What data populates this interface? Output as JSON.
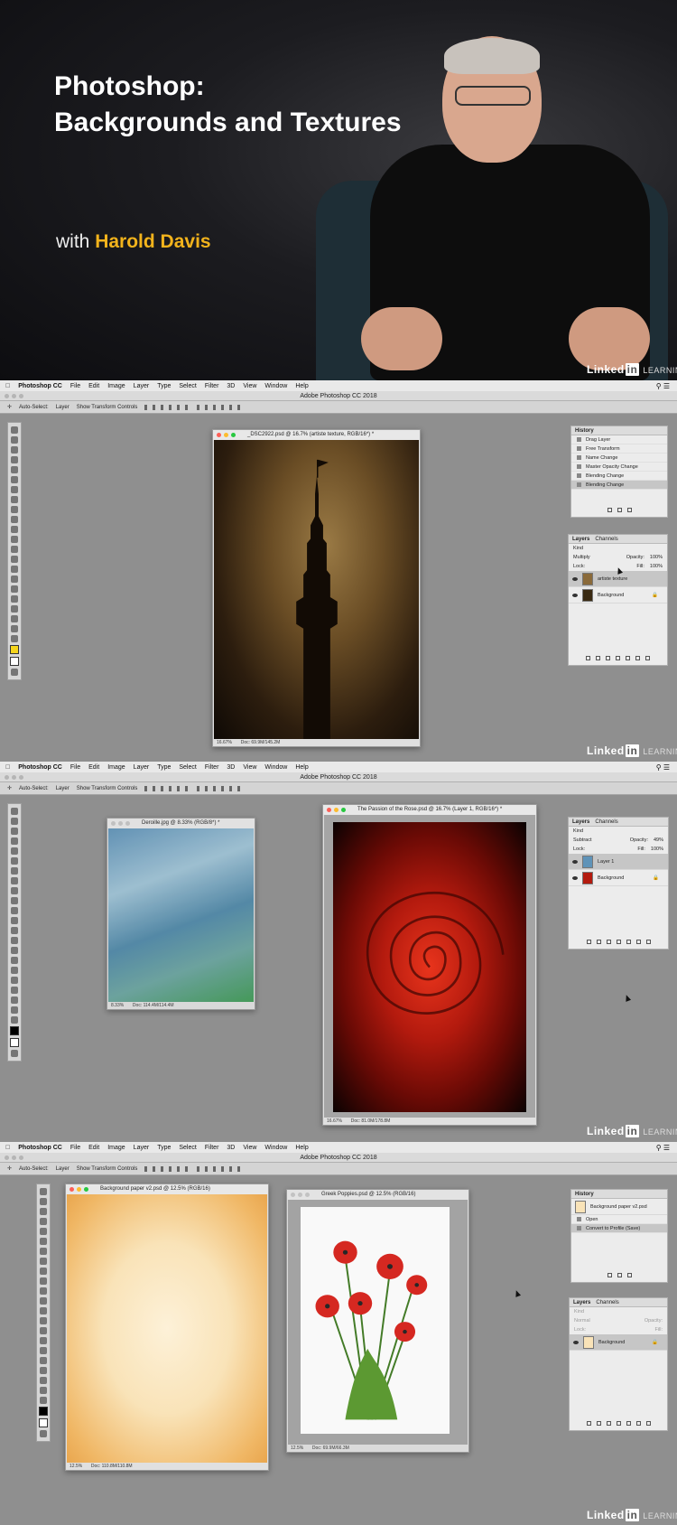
{
  "hero": {
    "title_line1": "Photoshop:",
    "title_line2": "Backgrounds and Textures",
    "with_prefix": "with",
    "author": "Harold Davis",
    "brand_linked": "Linked",
    "brand_in": "in",
    "brand_learning": "LEARNING",
    "accent": "#f2b31c"
  },
  "menubar": {
    "apple_icon": "apple-icon",
    "app": "Photoshop CC",
    "items": [
      "File",
      "Edit",
      "Image",
      "Layer",
      "Type",
      "Select",
      "Filter",
      "3D",
      "View",
      "Window",
      "Help"
    ]
  },
  "app_title": "Adobe Photoshop CC 2018",
  "options": {
    "auto_select": "Auto-Select:",
    "layer": "Layer",
    "show_transform": "Show Transform Controls"
  },
  "shot1": {
    "doc": {
      "title": "_DSC2922.psd @ 16.7% (artiste texture, RGB/16*) *",
      "zoom": "16.67%",
      "size": "Doc: 69.9M/145.2M"
    },
    "history": {
      "tab": "History",
      "items": [
        "Drag Layer",
        "Free Transform",
        "Name Change",
        "Master Opacity Change",
        "Blending Change",
        "Blending Change"
      ]
    },
    "layers": {
      "tab1": "Layers",
      "tab2": "Channels",
      "kind": "Kind",
      "blend": "Multiply",
      "opacity_label": "Opacity:",
      "opacity": "100%",
      "lock": "Lock:",
      "fill_label": "Fill:",
      "fill": "100%",
      "items": [
        "artiste texture",
        "Background"
      ]
    }
  },
  "shot2": {
    "doc1": {
      "title": "Deroille.jpg @ 8.33% (RGB/8*) *",
      "zoom": "8.33%",
      "size": "Doc: 114.4M/114.4M"
    },
    "doc2": {
      "title": "The Passion of the Rose.psd @ 16.7% (Layer 1, RGB/16*) *",
      "zoom": "16.67%",
      "size": "Doc: 81.0M/178.8M"
    },
    "layers": {
      "tab1": "Layers",
      "tab2": "Channels",
      "kind": "Kind",
      "blend": "Subtract",
      "opacity_label": "Opacity:",
      "opacity": "49%",
      "lock": "Lock:",
      "fill_label": "Fill:",
      "fill": "100%",
      "items": [
        "Layer 1",
        "Background"
      ]
    }
  },
  "shot3": {
    "doc1": {
      "title": "Background paper v2.psd @ 12.5% (RGB/16)",
      "zoom": "12.5%",
      "size": "Doc: 110.8M/110.8M"
    },
    "doc2": {
      "title": "Greek Poppies.psd @ 12.5% (RGB/16)",
      "zoom": "12.5%",
      "size": "Doc: 69.9M/66.3M"
    },
    "history": {
      "tab": "History",
      "snapshot": "Background paper v2.psd",
      "items": [
        "Open",
        "Convert to Profile (Save)"
      ]
    },
    "layers": {
      "tab1": "Layers",
      "tab2": "Channels",
      "kind": "Kind",
      "blend": "Normal",
      "opacity_label": "Opacity:",
      "opacity": "",
      "lock": "Lock:",
      "fill_label": "Fill:",
      "fill": "",
      "items": [
        "Background"
      ]
    }
  }
}
